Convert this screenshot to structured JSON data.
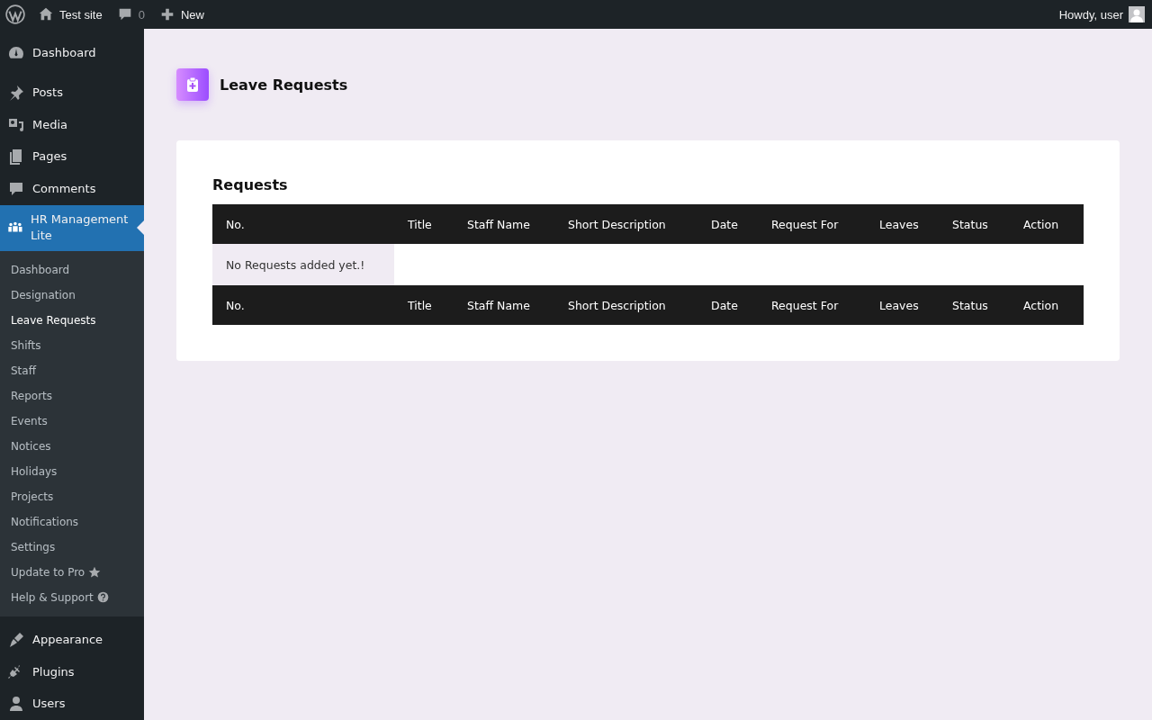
{
  "admin_bar": {
    "site_name": "Test site",
    "comments_count": "0",
    "new_label": "New",
    "greeting": "Howdy, user"
  },
  "sidebar": {
    "top_items": [
      {
        "label": "Dashboard"
      },
      {
        "label": "Posts"
      },
      {
        "label": "Media"
      },
      {
        "label": "Pages"
      },
      {
        "label": "Comments"
      }
    ],
    "current": {
      "label": "HR Management Lite",
      "selected": true
    },
    "submenu": [
      {
        "label": "Dashboard",
        "selected": false,
        "kind": "plain"
      },
      {
        "label": "Designation",
        "selected": false,
        "kind": "plain"
      },
      {
        "label": "Leave Requests",
        "selected": true,
        "kind": "plain"
      },
      {
        "label": "Shifts",
        "selected": false,
        "kind": "plain"
      },
      {
        "label": "Staff",
        "selected": false,
        "kind": "plain"
      },
      {
        "label": "Reports",
        "selected": false,
        "kind": "plain"
      },
      {
        "label": "Events",
        "selected": false,
        "kind": "plain"
      },
      {
        "label": "Notices",
        "selected": false,
        "kind": "plain"
      },
      {
        "label": "Holidays",
        "selected": false,
        "kind": "plain"
      },
      {
        "label": "Projects",
        "selected": false,
        "kind": "plain"
      },
      {
        "label": "Notifications",
        "selected": false,
        "kind": "plain"
      },
      {
        "label": "Settings",
        "selected": false,
        "kind": "plain"
      },
      {
        "label": "Update to Pro",
        "selected": false,
        "kind": "star"
      },
      {
        "label": "Help & Support",
        "selected": false,
        "kind": "help"
      }
    ],
    "bottom_items": [
      {
        "label": "Appearance"
      },
      {
        "label": "Plugins"
      },
      {
        "label": "Users"
      }
    ]
  },
  "page": {
    "title": "Leave Requests"
  },
  "card": {
    "title": "Requests",
    "columns": [
      "No.",
      "Title",
      "Staff Name",
      "Short Description",
      "Date",
      "Request For",
      "Leaves",
      "Status",
      "Action"
    ],
    "empty_message": "No Requests added yet.!",
    "footer_columns": [
      "No.",
      "Title",
      "Staff Name",
      "Short Description",
      "Date",
      "Request For",
      "Leaves",
      "Status",
      "Action"
    ]
  }
}
